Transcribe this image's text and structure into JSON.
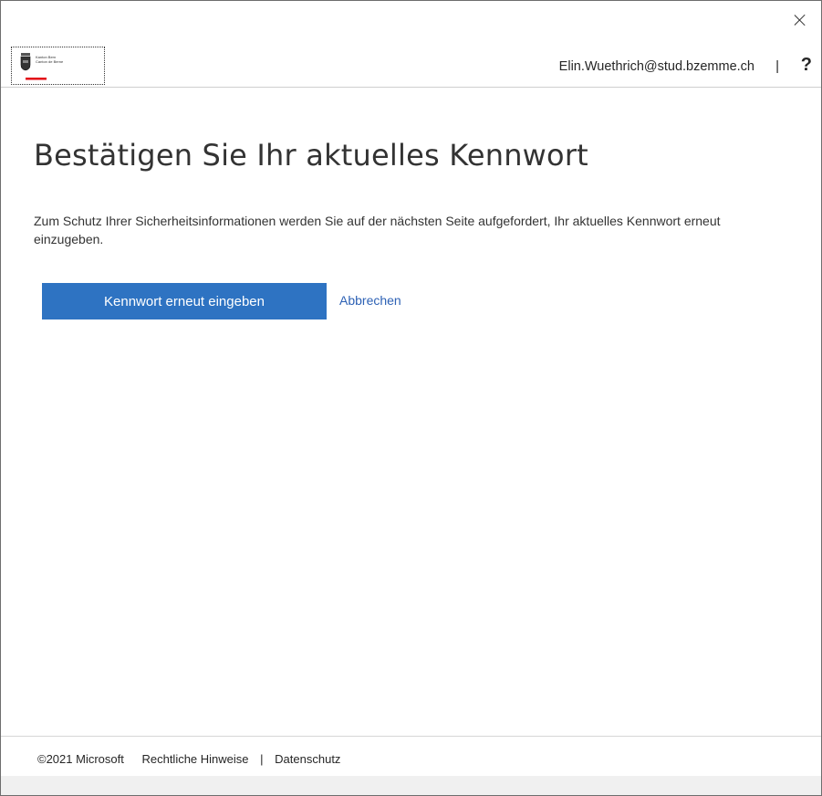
{
  "window": {
    "close_icon": "close-icon"
  },
  "header": {
    "logo_icon": "canton-bern-logo",
    "logo_line1": "Kanton Bern",
    "logo_line2": "Canton de Berne",
    "user_email": "Elin.Wuethrich@stud.bzemme.ch",
    "separator": "|",
    "help_label": "?"
  },
  "main": {
    "title": "Bestätigen Sie Ihr aktuelles Kennwort",
    "description": "Zum Schutz Ihrer Sicherheitsinformationen werden Sie auf der nächsten Seite aufgefordert, Ihr aktuelles Kennwort erneut einzugeben.",
    "primary_button": "Kennwort erneut eingeben",
    "cancel_link": "Abbrechen"
  },
  "footer": {
    "copyright": "©2021 Microsoft",
    "legal_link": "Rechtliche Hinweise",
    "separator": "|",
    "privacy_link": "Datenschutz"
  },
  "colors": {
    "primary": "#2e73c2",
    "link": "#2e62b5",
    "logo_accent": "#e30613"
  }
}
